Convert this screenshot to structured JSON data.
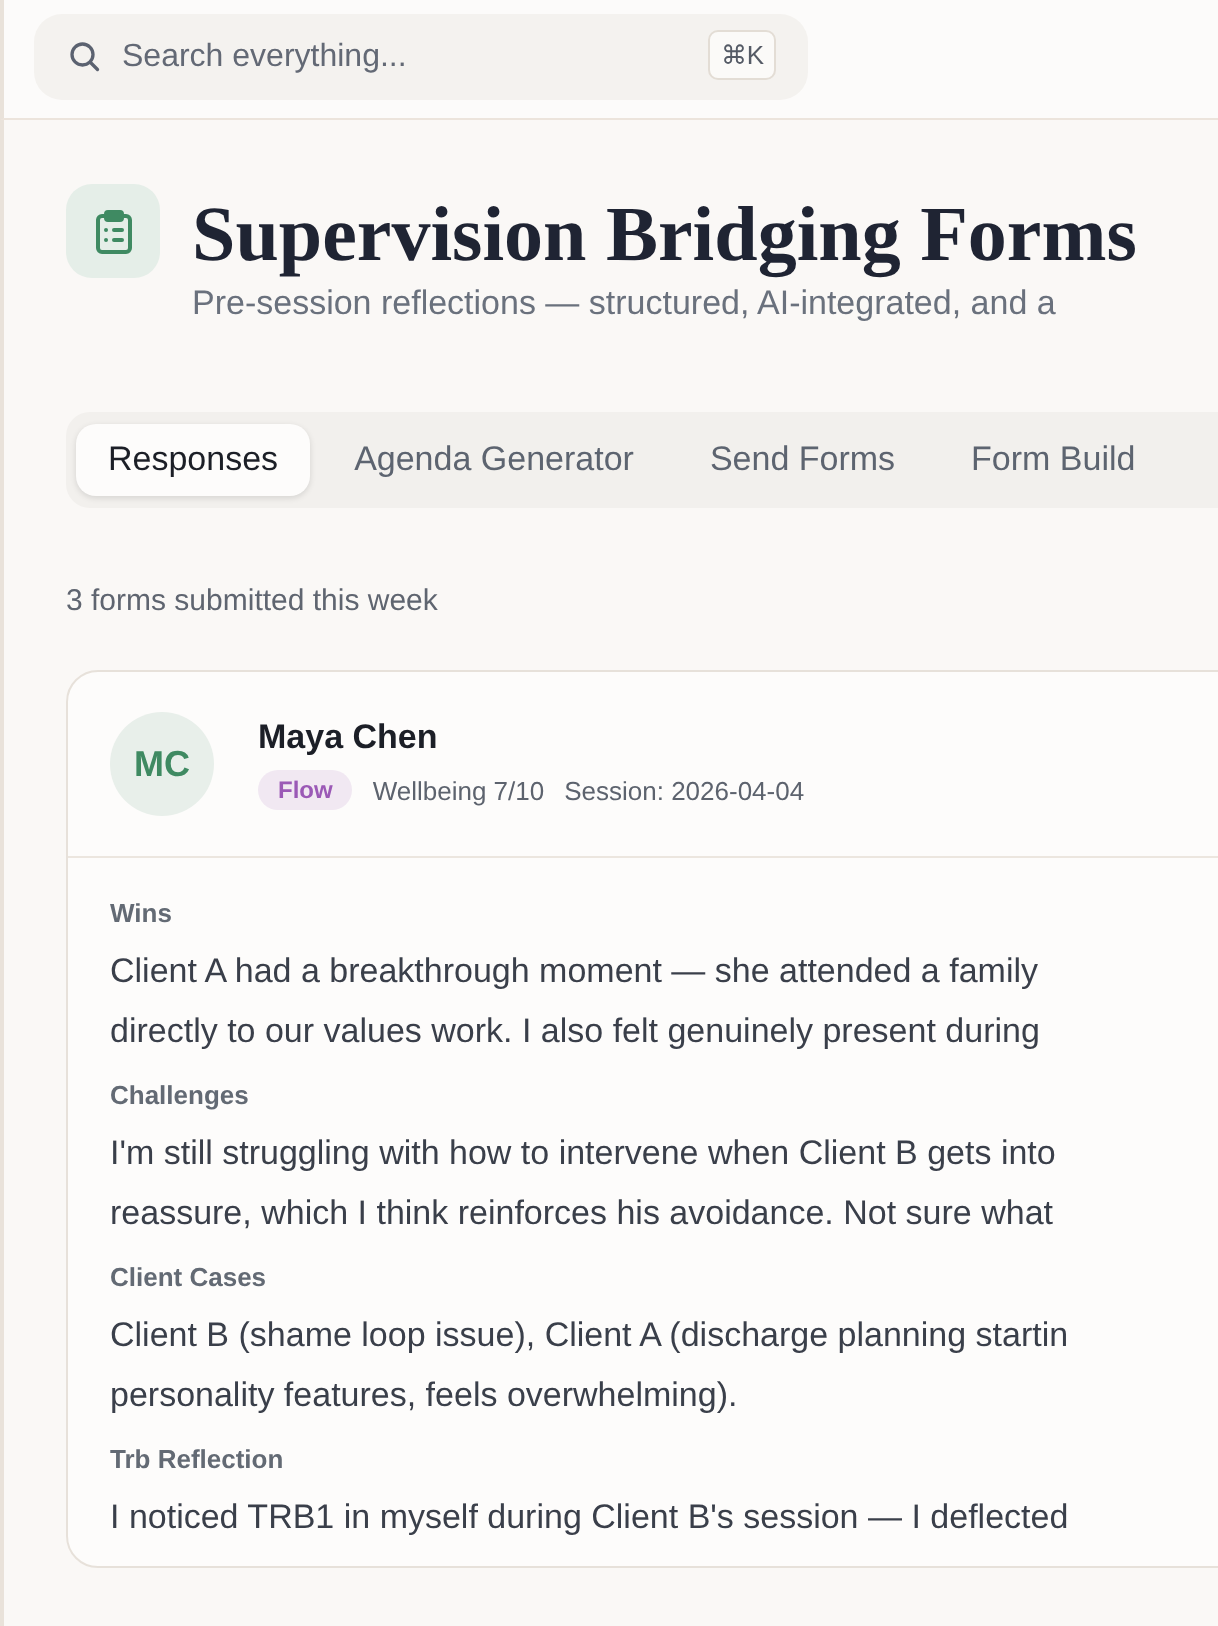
{
  "search": {
    "placeholder": "Search everything...",
    "shortcut": "⌘K"
  },
  "header": {
    "title": "Supervision Bridging Forms",
    "subtitle": "Pre-session reflections — structured, AI-integrated, and a"
  },
  "tabs": [
    {
      "label": "Responses",
      "selected": true
    },
    {
      "label": "Agenda Generator",
      "selected": false
    },
    {
      "label": "Send Forms",
      "selected": false
    },
    {
      "label": "Form Build",
      "selected": false
    }
  ],
  "summary": "3 forms submitted this week",
  "responses": [
    {
      "initials": "MC",
      "name": "Maya Chen",
      "tag": {
        "label": "Flow",
        "color": "#9b59b6"
      },
      "wellbeing": "Wellbeing 7/10",
      "session": "Session: 2026-04-04",
      "sections": [
        {
          "label": "Wins",
          "lines": [
            "Client A had a breakthrough moment — she attended a family",
            "directly to our values work. I also felt genuinely present during"
          ]
        },
        {
          "label": "Challenges",
          "lines": [
            "I'm still struggling with how to intervene when Client B gets into",
            "reassure, which I think reinforces his avoidance. Not sure what"
          ]
        },
        {
          "label": "Client Cases",
          "lines": [
            "Client B (shame loop issue), Client A (discharge planning startin",
            "personality features, feels overwhelming)."
          ]
        },
        {
          "label": "Trb Reflection",
          "lines": [
            "I noticed TRB1 in myself during Client B's session — I deflected"
          ]
        }
      ]
    }
  ]
}
